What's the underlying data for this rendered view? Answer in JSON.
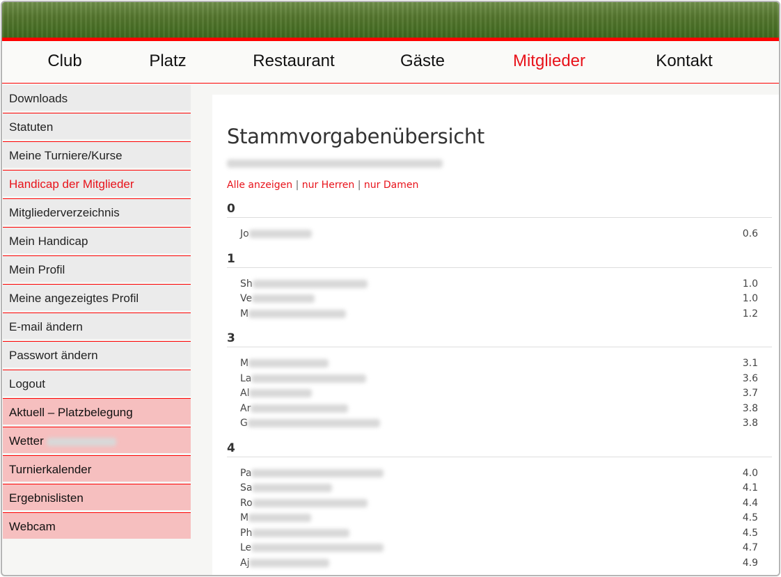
{
  "nav": [
    "Club",
    "Platz",
    "Restaurant",
    "Gäste",
    "Mitglieder",
    "Kontakt"
  ],
  "nav_active": "Mitglieder",
  "sidebar": [
    {
      "label": "Downloads"
    },
    {
      "label": "Statuten"
    },
    {
      "label": "Meine Turniere/Kurse"
    },
    {
      "label": "Handicap der Mitglieder",
      "active": true
    },
    {
      "label": "Mitgliederverzeichnis"
    },
    {
      "label": "Mein Handicap"
    },
    {
      "label": "Mein Profil"
    },
    {
      "label": "Meine angezeigtes Profil"
    },
    {
      "label": "E-mail ändern"
    },
    {
      "label": "Passwort ändern"
    },
    {
      "label": "Logout"
    },
    {
      "label": "Aktuell – Platzbelegung",
      "pink": true
    },
    {
      "label": "Wetter",
      "pink": true,
      "blur": true
    },
    {
      "label": "Turnierkalender",
      "pink": true
    },
    {
      "label": "Ergebnislisten",
      "pink": true
    },
    {
      "label": "Webcam",
      "pink": true
    }
  ],
  "title": "Stammvorgabenübersicht",
  "filters": {
    "all": "Alle anzeigen",
    "men": "nur Herren",
    "women": "nur Damen",
    "sep": "|"
  },
  "groups": [
    {
      "heading": "0",
      "rows": [
        {
          "name": "Jo",
          "value": "0.6"
        }
      ]
    },
    {
      "heading": "1",
      "rows": [
        {
          "name": "Sh",
          "value": "1.0"
        },
        {
          "name": "Ve",
          "value": "1.0"
        },
        {
          "name": "M",
          "value": "1.2"
        }
      ]
    },
    {
      "heading": "3",
      "rows": [
        {
          "name": "M",
          "value": "3.1"
        },
        {
          "name": "La",
          "value": "3.6"
        },
        {
          "name": "Al",
          "value": "3.7"
        },
        {
          "name": "Ar",
          "value": "3.8"
        },
        {
          "name": "G",
          "value": "3.8"
        }
      ]
    },
    {
      "heading": "4",
      "rows": [
        {
          "name": "Pa",
          "value": "4.0"
        },
        {
          "name": "Sa",
          "value": "4.1"
        },
        {
          "name": "Ro",
          "value": "4.4"
        },
        {
          "name": "M",
          "value": "4.5"
        },
        {
          "name": "Ph",
          "value": "4.5"
        },
        {
          "name": "Le",
          "value": "4.7"
        },
        {
          "name": "Aj",
          "value": "4.9"
        }
      ]
    }
  ]
}
